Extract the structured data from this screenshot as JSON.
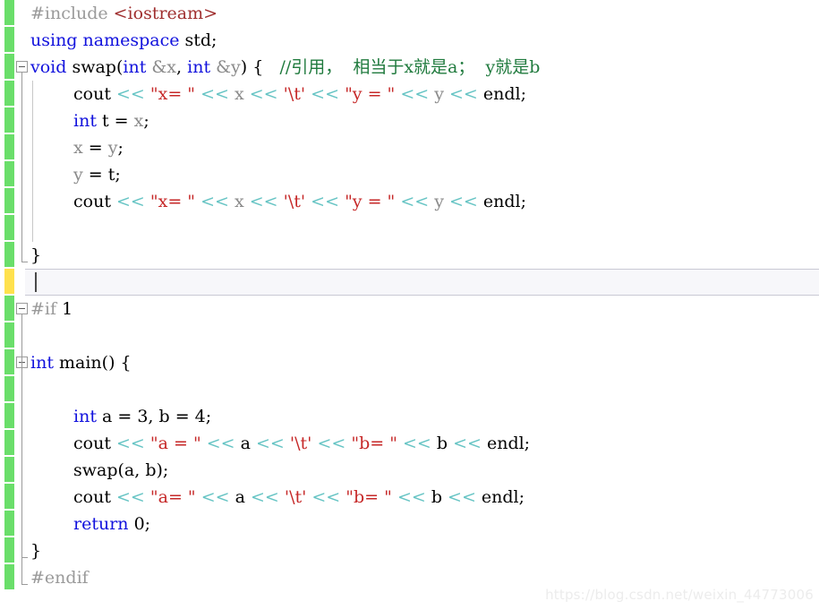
{
  "editor": {
    "watermark": "https://blog.csdn.net/weixin_44773006",
    "colors": {
      "background": "#ffffff",
      "change_bar_modified": "#6ade6a",
      "change_bar_current": "#ffe14d",
      "current_line_bg": "#f7f7fa",
      "current_line_border": "#c9c9d4",
      "keyword": "#1111dd",
      "string": "#c62828",
      "comment": "#1f7a3d",
      "preprocessor": "#9a9a9a",
      "header_name": "#a03030",
      "operator": "#66c4c4",
      "parameter": "#8a8a8a",
      "plain": "#000000",
      "fold_marker": "#9a9a9a"
    },
    "lines": [
      {
        "n": 1,
        "indent": 0,
        "fold": "none",
        "marker": "modified",
        "tokens": [
          {
            "c": "t-pre",
            "s": "#include "
          },
          {
            "c": "t-header",
            "s": "<iostream>"
          }
        ]
      },
      {
        "n": 2,
        "indent": 0,
        "fold": "none",
        "marker": "modified",
        "tokens": [
          {
            "c": "t-kw",
            "s": "using namespace "
          },
          {
            "c": "t-plain",
            "s": "std;"
          }
        ]
      },
      {
        "n": 3,
        "indent": 0,
        "fold": "open",
        "marker": "modified",
        "tokens": [
          {
            "c": "t-kw",
            "s": "void"
          },
          {
            "c": "t-plain",
            "s": " swap("
          },
          {
            "c": "t-kw",
            "s": "int"
          },
          {
            "c": "t-plain",
            "s": " "
          },
          {
            "c": "t-param",
            "s": "&x"
          },
          {
            "c": "t-plain",
            "s": ", "
          },
          {
            "c": "t-kw",
            "s": "int"
          },
          {
            "c": "t-plain",
            "s": " "
          },
          {
            "c": "t-param",
            "s": "&y"
          },
          {
            "c": "t-plain",
            "s": ") {   "
          },
          {
            "c": "t-comment",
            "s": "//引用，  相当于x就是a；  y就是b"
          }
        ]
      },
      {
        "n": 4,
        "indent": 1,
        "fold": "none",
        "marker": "modified",
        "tokens": [
          {
            "c": "t-plain",
            "s": "cout "
          },
          {
            "c": "t-op",
            "s": "<<"
          },
          {
            "c": "t-plain",
            "s": " "
          },
          {
            "c": "t-str",
            "s": "\"x= \""
          },
          {
            "c": "t-plain",
            "s": " "
          },
          {
            "c": "t-op",
            "s": "<<"
          },
          {
            "c": "t-plain",
            "s": " "
          },
          {
            "c": "t-param",
            "s": "x"
          },
          {
            "c": "t-plain",
            "s": " "
          },
          {
            "c": "t-op",
            "s": "<<"
          },
          {
            "c": "t-plain",
            "s": " "
          },
          {
            "c": "t-str",
            "s": "'\\t'"
          },
          {
            "c": "t-plain",
            "s": " "
          },
          {
            "c": "t-op",
            "s": "<<"
          },
          {
            "c": "t-plain",
            "s": " "
          },
          {
            "c": "t-str",
            "s": "\"y = \""
          },
          {
            "c": "t-plain",
            "s": " "
          },
          {
            "c": "t-op",
            "s": "<<"
          },
          {
            "c": "t-plain",
            "s": " "
          },
          {
            "c": "t-param",
            "s": "y"
          },
          {
            "c": "t-plain",
            "s": " "
          },
          {
            "c": "t-op",
            "s": "<<"
          },
          {
            "c": "t-plain",
            "s": " endl;"
          }
        ]
      },
      {
        "n": 5,
        "indent": 1,
        "fold": "none",
        "marker": "modified",
        "tokens": [
          {
            "c": "t-kw",
            "s": "int"
          },
          {
            "c": "t-plain",
            "s": " t = "
          },
          {
            "c": "t-param",
            "s": "x"
          },
          {
            "c": "t-plain",
            "s": ";"
          }
        ]
      },
      {
        "n": 6,
        "indent": 1,
        "fold": "none",
        "marker": "modified",
        "tokens": [
          {
            "c": "t-param",
            "s": "x"
          },
          {
            "c": "t-plain",
            "s": " = "
          },
          {
            "c": "t-param",
            "s": "y"
          },
          {
            "c": "t-plain",
            "s": ";"
          }
        ]
      },
      {
        "n": 7,
        "indent": 1,
        "fold": "none",
        "marker": "modified",
        "tokens": [
          {
            "c": "t-param",
            "s": "y"
          },
          {
            "c": "t-plain",
            "s": " = t;"
          }
        ]
      },
      {
        "n": 8,
        "indent": 1,
        "fold": "none",
        "marker": "modified",
        "tokens": [
          {
            "c": "t-plain",
            "s": "cout "
          },
          {
            "c": "t-op",
            "s": "<<"
          },
          {
            "c": "t-plain",
            "s": " "
          },
          {
            "c": "t-str",
            "s": "\"x= \""
          },
          {
            "c": "t-plain",
            "s": " "
          },
          {
            "c": "t-op",
            "s": "<<"
          },
          {
            "c": "t-plain",
            "s": " "
          },
          {
            "c": "t-param",
            "s": "x"
          },
          {
            "c": "t-plain",
            "s": " "
          },
          {
            "c": "t-op",
            "s": "<<"
          },
          {
            "c": "t-plain",
            "s": " "
          },
          {
            "c": "t-str",
            "s": "'\\t'"
          },
          {
            "c": "t-plain",
            "s": " "
          },
          {
            "c": "t-op",
            "s": "<<"
          },
          {
            "c": "t-plain",
            "s": " "
          },
          {
            "c": "t-str",
            "s": "\"y = \""
          },
          {
            "c": "t-plain",
            "s": " "
          },
          {
            "c": "t-op",
            "s": "<<"
          },
          {
            "c": "t-plain",
            "s": " "
          },
          {
            "c": "t-param",
            "s": "y"
          },
          {
            "c": "t-plain",
            "s": " "
          },
          {
            "c": "t-op",
            "s": "<<"
          },
          {
            "c": "t-plain",
            "s": " endl;"
          }
        ]
      },
      {
        "n": 9,
        "indent": 1,
        "fold": "none",
        "marker": "modified",
        "tokens": []
      },
      {
        "n": 10,
        "indent": 0,
        "fold": "none",
        "marker": "modified",
        "tokens": [
          {
            "c": "t-plain",
            "s": "}"
          }
        ]
      },
      {
        "n": 11,
        "indent": 0,
        "fold": "none",
        "marker": "current",
        "tokens": []
      },
      {
        "n": 12,
        "indent": 0,
        "fold": "open",
        "marker": "modified",
        "tokens": [
          {
            "c": "t-pre",
            "s": "#if "
          },
          {
            "c": "t-num",
            "s": "1"
          }
        ]
      },
      {
        "n": 13,
        "indent": 0,
        "fold": "none",
        "marker": "modified",
        "tokens": []
      },
      {
        "n": 14,
        "indent": 0,
        "fold": "open",
        "marker": "modified",
        "tokens": [
          {
            "c": "t-kw",
            "s": "int"
          },
          {
            "c": "t-plain",
            "s": " main() {"
          }
        ]
      },
      {
        "n": 15,
        "indent": 0,
        "fold": "none",
        "marker": "modified",
        "tokens": []
      },
      {
        "n": 16,
        "indent": 1,
        "fold": "none",
        "marker": "modified",
        "tokens": [
          {
            "c": "t-kw",
            "s": "int"
          },
          {
            "c": "t-plain",
            "s": " a = "
          },
          {
            "c": "t-num",
            "s": "3"
          },
          {
            "c": "t-plain",
            "s": ", b = "
          },
          {
            "c": "t-num",
            "s": "4"
          },
          {
            "c": "t-plain",
            "s": ";"
          }
        ]
      },
      {
        "n": 17,
        "indent": 1,
        "fold": "none",
        "marker": "modified",
        "tokens": [
          {
            "c": "t-plain",
            "s": "cout "
          },
          {
            "c": "t-op",
            "s": "<<"
          },
          {
            "c": "t-plain",
            "s": " "
          },
          {
            "c": "t-str",
            "s": "\"a = \""
          },
          {
            "c": "t-plain",
            "s": " "
          },
          {
            "c": "t-op",
            "s": "<<"
          },
          {
            "c": "t-plain",
            "s": " a "
          },
          {
            "c": "t-op",
            "s": "<<"
          },
          {
            "c": "t-plain",
            "s": " "
          },
          {
            "c": "t-str",
            "s": "'\\t'"
          },
          {
            "c": "t-plain",
            "s": " "
          },
          {
            "c": "t-op",
            "s": "<<"
          },
          {
            "c": "t-plain",
            "s": " "
          },
          {
            "c": "t-str",
            "s": "\"b= \""
          },
          {
            "c": "t-plain",
            "s": " "
          },
          {
            "c": "t-op",
            "s": "<<"
          },
          {
            "c": "t-plain",
            "s": " b "
          },
          {
            "c": "t-op",
            "s": "<<"
          },
          {
            "c": "t-plain",
            "s": " endl;"
          }
        ]
      },
      {
        "n": 18,
        "indent": 1,
        "fold": "none",
        "marker": "modified",
        "tokens": [
          {
            "c": "t-plain",
            "s": "swap(a, b);"
          }
        ]
      },
      {
        "n": 19,
        "indent": 1,
        "fold": "none",
        "marker": "modified",
        "tokens": [
          {
            "c": "t-plain",
            "s": "cout "
          },
          {
            "c": "t-op",
            "s": "<<"
          },
          {
            "c": "t-plain",
            "s": " "
          },
          {
            "c": "t-str",
            "s": "\"a= \""
          },
          {
            "c": "t-plain",
            "s": " "
          },
          {
            "c": "t-op",
            "s": "<<"
          },
          {
            "c": "t-plain",
            "s": " a "
          },
          {
            "c": "t-op",
            "s": "<<"
          },
          {
            "c": "t-plain",
            "s": " "
          },
          {
            "c": "t-str",
            "s": "'\\t'"
          },
          {
            "c": "t-plain",
            "s": " "
          },
          {
            "c": "t-op",
            "s": "<<"
          },
          {
            "c": "t-plain",
            "s": " "
          },
          {
            "c": "t-str",
            "s": "\"b= \""
          },
          {
            "c": "t-plain",
            "s": " "
          },
          {
            "c": "t-op",
            "s": "<<"
          },
          {
            "c": "t-plain",
            "s": " b "
          },
          {
            "c": "t-op",
            "s": "<<"
          },
          {
            "c": "t-plain",
            "s": " endl;"
          }
        ]
      },
      {
        "n": 20,
        "indent": 1,
        "fold": "none",
        "marker": "modified",
        "tokens": [
          {
            "c": "t-kw",
            "s": "return"
          },
          {
            "c": "t-plain",
            "s": " "
          },
          {
            "c": "t-num",
            "s": "0"
          },
          {
            "c": "t-plain",
            "s": ";"
          }
        ]
      },
      {
        "n": 21,
        "indent": 0,
        "fold": "none",
        "marker": "modified",
        "tokens": [
          {
            "c": "t-plain",
            "s": "}"
          }
        ]
      },
      {
        "n": 22,
        "indent": 0,
        "fold": "none",
        "marker": "modified",
        "tokens": [
          {
            "c": "t-pre",
            "s": "#endif"
          }
        ]
      }
    ]
  }
}
